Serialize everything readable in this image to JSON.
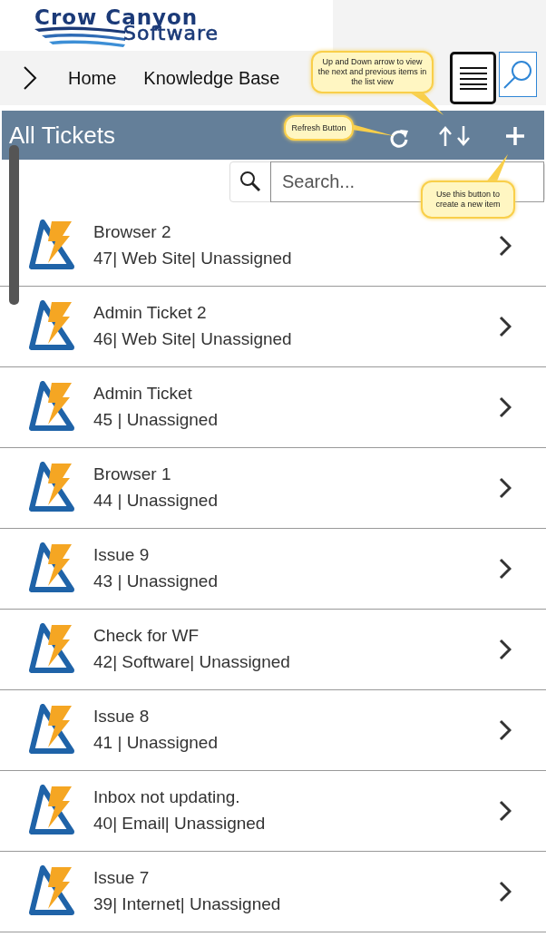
{
  "logo": {
    "line_1": "Crow Canyon",
    "line_2": "Software"
  },
  "nav": {
    "links": [
      "Home",
      "Knowledge Base"
    ]
  },
  "header": {
    "title": "All Tickets"
  },
  "search": {
    "placeholder": "Search..."
  },
  "callouts": [
    {
      "kind": "arrows",
      "text": "Up and Down arrow to view the next and previous items in the list view"
    },
    {
      "kind": "refresh",
      "text": "Refresh Button"
    },
    {
      "kind": "new",
      "text": "Use this button to create a new item"
    }
  ],
  "tickets": [
    {
      "title": "Browser 2",
      "details": "47| Web Site| Unassigned"
    },
    {
      "title": "Admin Ticket 2",
      "details": "46| Web Site| Unassigned"
    },
    {
      "title": "Admin Ticket",
      "details": "45 | Unassigned"
    },
    {
      "title": "Browser 1",
      "details": "44 | Unassigned"
    },
    {
      "title": "Issue 9",
      "details": "43 | Unassigned"
    },
    {
      "title": "Check for WF",
      "details": "42| Software| Unassigned"
    },
    {
      "title": "Issue 8",
      "details": "41 | Unassigned"
    },
    {
      "title": "Inbox not updating.",
      "details": "40| Email| Unassigned"
    },
    {
      "title": "Issue 7",
      "details": "39| Internet| Unassigned"
    }
  ]
}
